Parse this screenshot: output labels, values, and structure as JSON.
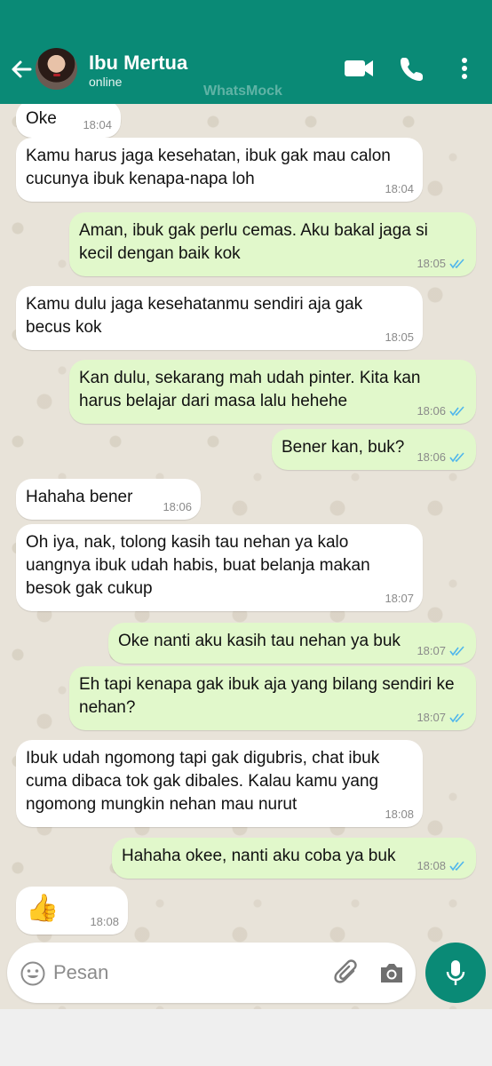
{
  "header": {
    "contact_name": "Ibu Mertua",
    "status": "online",
    "watermark": "WhatsMock",
    "accent_color": "#0a8a76"
  },
  "messages": [
    {
      "direction": "in",
      "text": "Oke",
      "time": "18:04"
    },
    {
      "direction": "in",
      "text": "Kamu harus jaga kesehatan, ibuk gak mau calon\ncucunya ibuk kenapa-napa loh",
      "time": "18:04"
    },
    {
      "direction": "out",
      "text": "Aman, ibuk gak perlu cemas. Aku bakal jaga si\nkecil dengan baik kok",
      "time": "18:05",
      "status": "read"
    },
    {
      "direction": "in",
      "text": "Kamu dulu jaga kesehatanmu sendiri aja gak\nbecus kok",
      "time": "18:05"
    },
    {
      "direction": "out",
      "text": "Kan dulu, sekarang mah udah pinter. Kita kan\nharus belajar dari masa lalu hehehe",
      "time": "18:06",
      "status": "read"
    },
    {
      "direction": "out",
      "text": "Bener kan, buk?",
      "time": "18:06",
      "status": "read"
    },
    {
      "direction": "in",
      "text": "Hahaha bener",
      "time": "18:06"
    },
    {
      "direction": "in",
      "text": "Oh iya, nak, tolong kasih tau nehan ya kalo\nuangnya ibuk udah habis, buat belanja makan\nbesok gak cukup",
      "time": "18:07"
    },
    {
      "direction": "out",
      "text": "Oke nanti aku kasih tau nehan ya buk",
      "time": "18:07",
      "status": "read"
    },
    {
      "direction": "out",
      "text": "Eh tapi kenapa gak ibuk aja yang bilang sendiri ke\nnehan?",
      "time": "18:07",
      "status": "read"
    },
    {
      "direction": "in",
      "text": "Ibuk udah ngomong tapi gak digubris, chat ibuk\ncuma dibaca tok gak dibales. Kalau kamu yang\nngomong mungkin nehan mau nurut",
      "time": "18:08"
    },
    {
      "direction": "out",
      "text": "Hahaha okee, nanti aku coba ya buk",
      "time": "18:08",
      "status": "read"
    },
    {
      "direction": "in",
      "text": "👍",
      "time": "18:08"
    }
  ],
  "composer": {
    "placeholder": "Pesan"
  },
  "colors": {
    "incoming_bubble": "#ffffff",
    "outgoing_bubble": "#e1f8cb",
    "read_ticks": "#4fb6ec"
  }
}
